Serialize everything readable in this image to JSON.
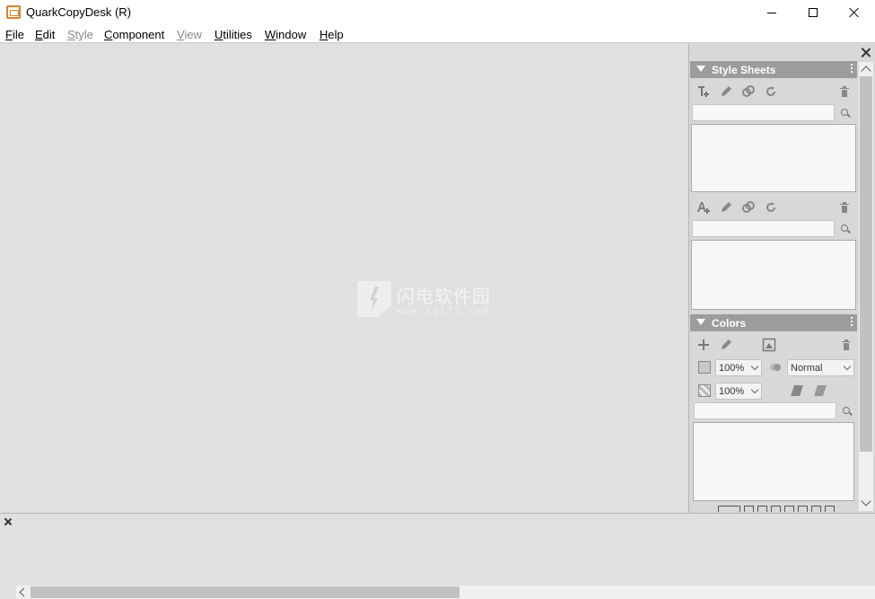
{
  "window": {
    "title": "QuarkCopyDesk (R)"
  },
  "menu": {
    "items": [
      {
        "label": "File",
        "enabled": true
      },
      {
        "label": "Edit",
        "enabled": true
      },
      {
        "label": "Style",
        "enabled": false
      },
      {
        "label": "Component",
        "enabled": true
      },
      {
        "label": "View",
        "enabled": false
      },
      {
        "label": "Utilities",
        "enabled": true
      },
      {
        "label": "Window",
        "enabled": true
      },
      {
        "label": "Help",
        "enabled": true
      }
    ]
  },
  "watermark": {
    "cn": "闪电软件园",
    "url": "www.sd173.com"
  },
  "style_sheets_panel": {
    "title": "Style Sheets"
  },
  "colors_panel": {
    "title": "Colors",
    "tint_fill": "100%",
    "tint_frame": "100%",
    "blend_mode": "Normal"
  },
  "colors": {
    "panel_header": "#9c9c9c",
    "workspace": "#e0e0e0",
    "app_icon": "#d9822b"
  }
}
